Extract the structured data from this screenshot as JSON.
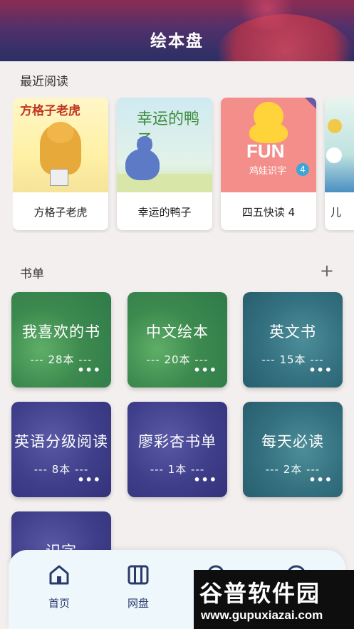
{
  "header": {
    "title": "绘本盘"
  },
  "recent": {
    "title": "最近阅读",
    "books": [
      {
        "label": "方格子老虎",
        "cover_title": "方格子老虎"
      },
      {
        "label": "幸运的鸭子",
        "cover_title": "幸运的鸭子"
      },
      {
        "label": "四五快读 4",
        "cover_title": "FUN",
        "cover_subtitle": "鸡娃识字",
        "cover_num": "4"
      },
      {
        "label": "儿"
      }
    ]
  },
  "booklists": {
    "title": "书单",
    "add_icon": "plus-icon",
    "items": [
      {
        "name": "我喜欢的书",
        "count": "--- 28本 ---",
        "more": "•••",
        "theme": "green"
      },
      {
        "name": "中文绘本",
        "count": "--- 20本 ---",
        "more": "•••",
        "theme": "green"
      },
      {
        "name": "英文书",
        "count": "--- 15本 ---",
        "more": "•••",
        "theme": "teal"
      },
      {
        "name": "英语分级阅读",
        "count": "--- 8本 ---",
        "more": "•••",
        "theme": "indigo"
      },
      {
        "name": "廖彩杏书单",
        "count": "--- 1本 ---",
        "more": "•••",
        "theme": "indigo"
      },
      {
        "name": "每天必读",
        "count": "--- 2本 ---",
        "more": "•••",
        "theme": "teal"
      },
      {
        "name": "识字",
        "theme": "indigo"
      }
    ]
  },
  "nav": {
    "items": [
      {
        "label": "首页",
        "icon": "home-icon",
        "active": true
      },
      {
        "label": "网盘",
        "icon": "columns-icon"
      },
      {
        "label": "",
        "icon": "search-icon"
      },
      {
        "label": "",
        "icon": "profile-icon"
      }
    ]
  },
  "watermark": {
    "line1": "谷普软件园",
    "line2": "www.gupuxiazai.com"
  },
  "colors": {
    "header_top": "#8c2c52",
    "header_bottom": "#2a2f66",
    "nav_text": "#2a3b6b"
  }
}
